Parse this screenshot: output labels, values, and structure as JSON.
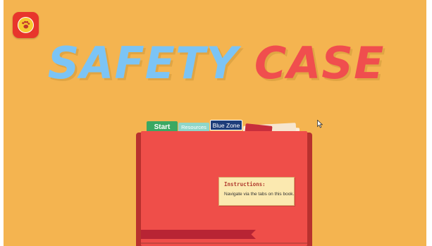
{
  "title": {
    "word1": "SAFETY",
    "word2": "CASE"
  },
  "tabs": {
    "start": "Start",
    "resources": "Resources",
    "blue_zone": "Blue Zone"
  },
  "instructions": {
    "heading": "Instructions:",
    "text": "Navigate via the tabs on this book."
  },
  "colors": {
    "background": "#f4b450",
    "title_blue": "#7cc4f5",
    "title_red": "#f04e4e",
    "book_red": "#ef4e49",
    "tab_start": "#3aa862",
    "tab_resources": "#8ed6c9",
    "tab_blue_zone": "#1d3d7a"
  },
  "icons": {
    "logo": "paw-badge-icon",
    "cursor": "mouse-pointer-icon"
  }
}
